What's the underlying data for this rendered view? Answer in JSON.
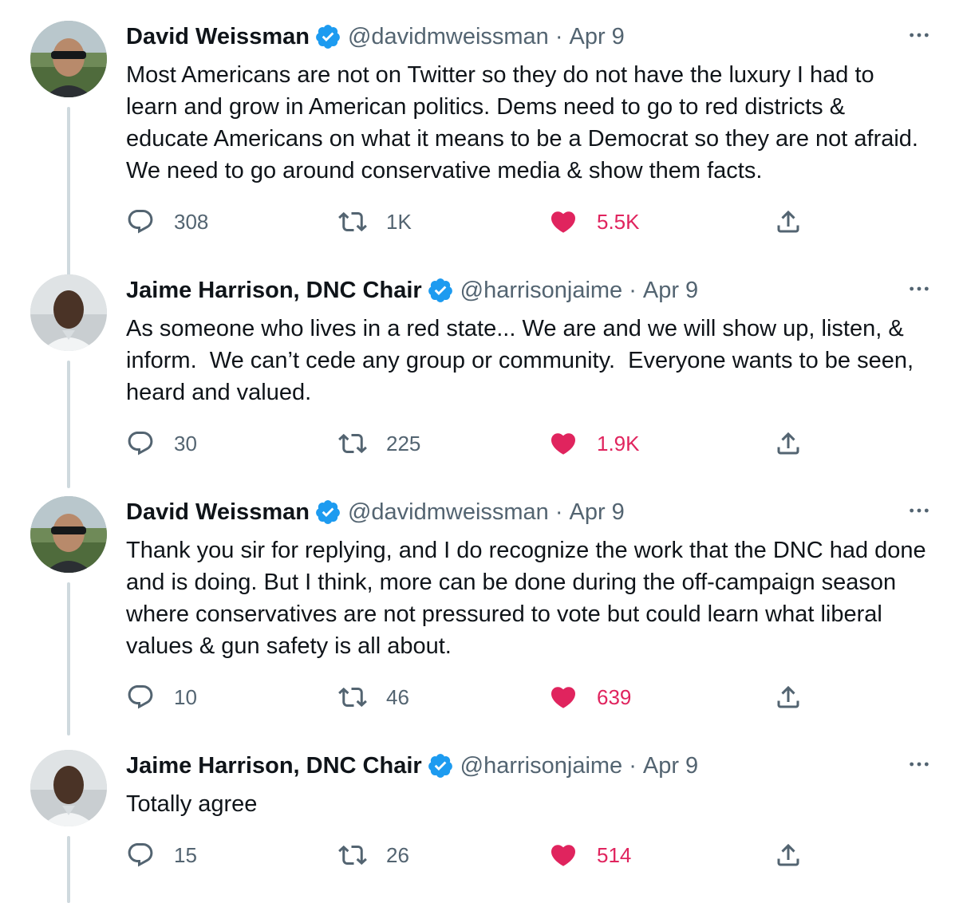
{
  "tweets": [
    {
      "author_name": "David Weissman",
      "handle": "@davidmweissman",
      "separator": "·",
      "date": "Apr 9",
      "text": "Most Americans are not on Twitter so they do not have the luxury I had to learn and grow in American politics. Dems need to go to red districts & educate Americans on what it means to be a Democrat so they are not afraid. We need to go around conservative media & show them facts.",
      "replies": "308",
      "retweets": "1K",
      "likes": "5.5K",
      "avatar": "avatar-david-weissman"
    },
    {
      "author_name": "Jaime Harrison, DNC Chair",
      "handle": "@harrisonjaime",
      "separator": "·",
      "date": "Apr 9",
      "text": "As someone who lives in a red state... We are and we will show up, listen, & inform.  We can’t cede any group or community.  Everyone wants to be seen, heard and valued.",
      "replies": "30",
      "retweets": "225",
      "likes": "1.9K",
      "avatar": "avatar-jaime-harrison"
    },
    {
      "author_name": "David Weissman",
      "handle": "@davidmweissman",
      "separator": "·",
      "date": "Apr 9",
      "text": "Thank you sir for replying, and I do recognize the work that the DNC had done and is doing. But I think, more can be done during the off-campaign season where conservatives are not pressured to vote but could learn what liberal values & gun safety is all about.",
      "replies": "10",
      "retweets": "46",
      "likes": "639",
      "avatar": "avatar-david-weissman"
    },
    {
      "author_name": "Jaime Harrison, DNC Chair",
      "handle": "@harrisonjaime",
      "separator": "·",
      "date": "Apr 9",
      "text": "Totally agree",
      "replies": "15",
      "retweets": "26",
      "likes": "514",
      "avatar": "avatar-jaime-harrison"
    }
  ],
  "colors": {
    "text_primary": "#0f1419",
    "text_secondary": "#536471",
    "like_active": "#e0245e",
    "verified_blue": "#1d9bf0",
    "thread_line": "#cfd9de"
  },
  "icons": {
    "reply": "reply-icon",
    "retweet": "retweet-icon",
    "like": "heart-icon",
    "share": "share-icon",
    "more": "more-icon",
    "verified": "verified-badge-icon"
  }
}
